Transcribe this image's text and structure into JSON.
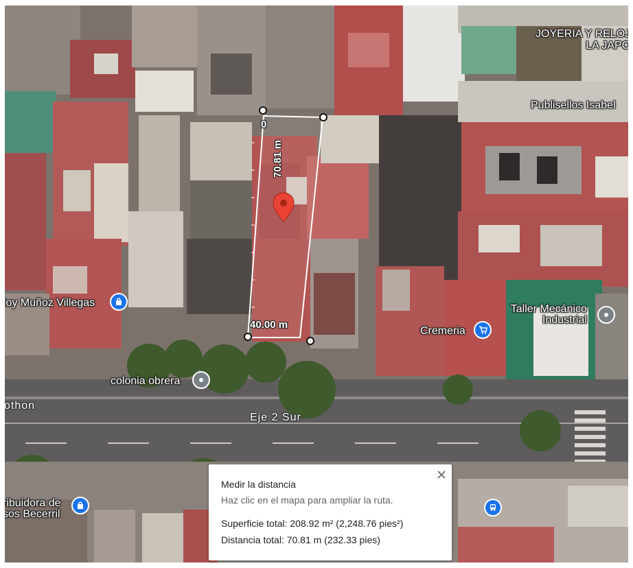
{
  "map": {
    "labels": {
      "joyeria_line1": "JOYERIA Y RELOJ",
      "joyeria_line2": "LA JAPO",
      "publisellos": "Publisellos Isabel",
      "munoz_villegas": "loy Muñoz Villegas",
      "taller_line1": "Taller Mecánico",
      "taller_line2": "Industrial",
      "cremeria": "Cremeria",
      "colonia_obrera": "colonia obrera",
      "othon": "othon",
      "eje2sur": "Eje 2 Sur",
      "distribuidora_line1": "ribuidora de",
      "distribuidora_line2": "sos Becerril"
    },
    "measurement": {
      "start_label": "0",
      "length_label": "70.81 m",
      "width_label": "40.00 m"
    },
    "icons": {
      "shopping": "shopping-bag-icon",
      "cart": "shopping-cart-icon",
      "place": "place-pin-icon",
      "bus": "bus-icon",
      "marker": "red-map-marker-icon"
    },
    "colors": {
      "pin_blue": "#1a73e8",
      "pin_grey": "#7a8288",
      "marker_red": "#ea4335"
    }
  },
  "panel": {
    "title": "Medir la distancia",
    "subtitle": "Haz clic en el mapa para ampliar la ruta.",
    "area": "Superficie total: 208.92 m² (2,248.76 pies²)",
    "distance": "Distancia total: 70.81 m (232.33 pies)"
  }
}
